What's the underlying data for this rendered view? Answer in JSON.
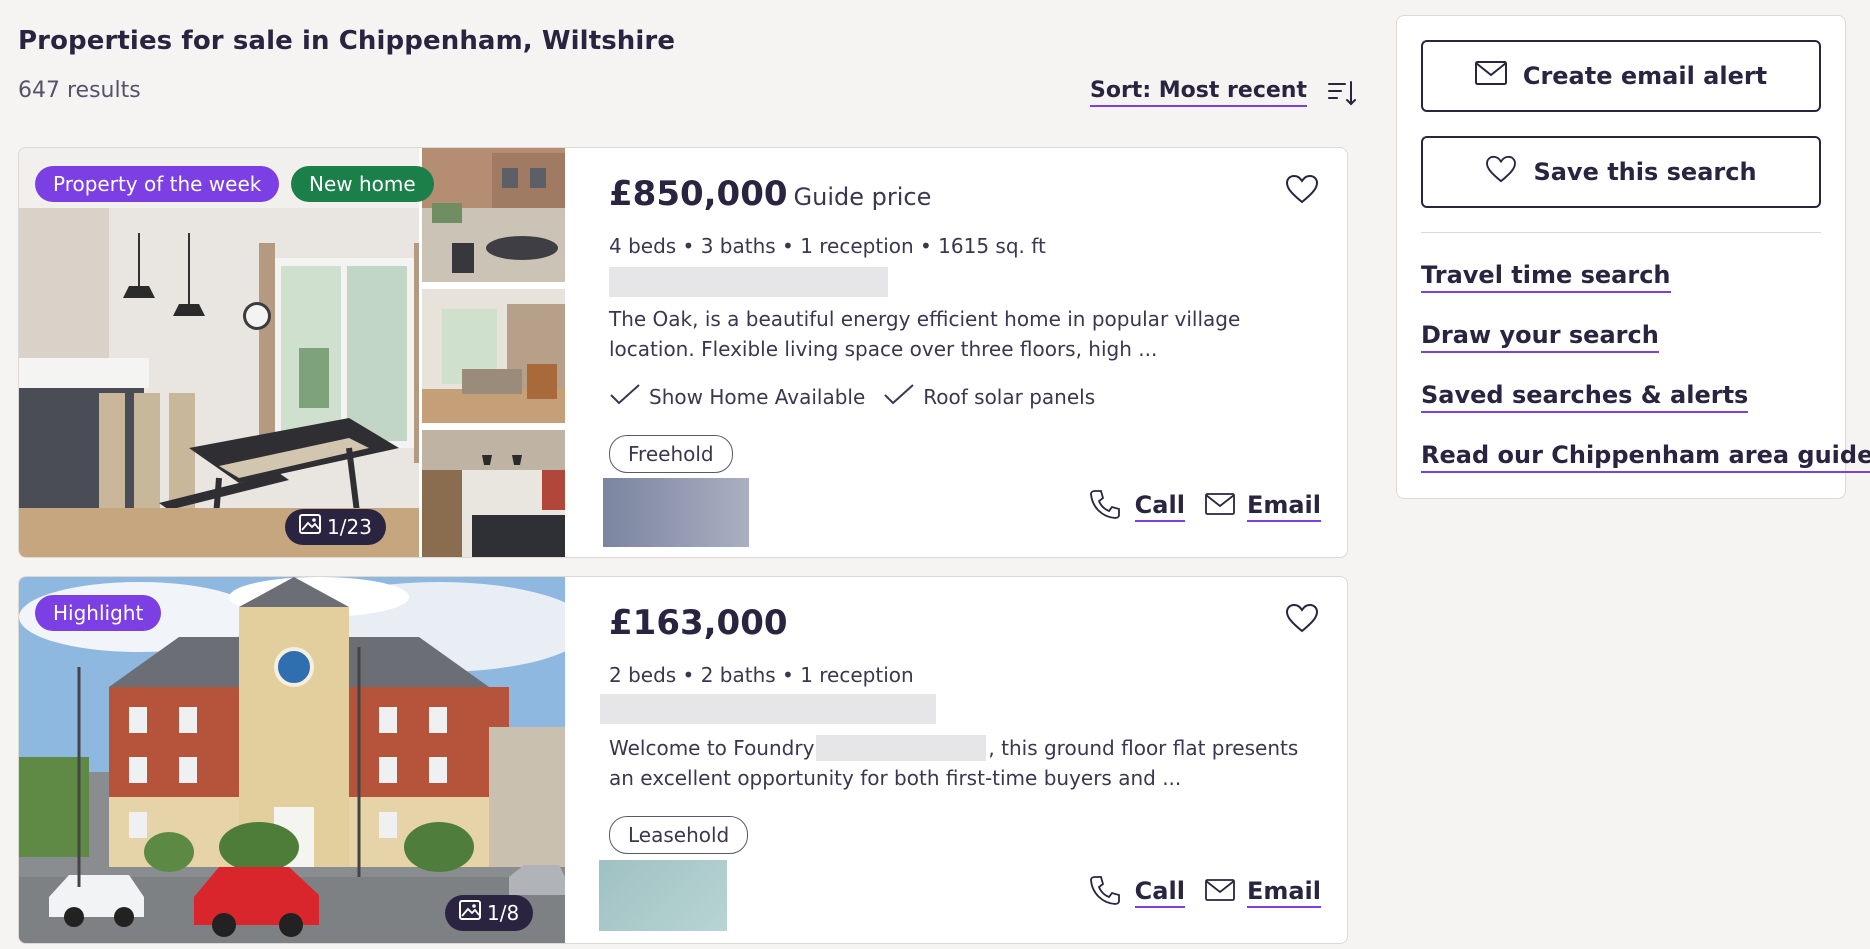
{
  "header": {
    "title": "Properties for sale in Chippenham, Wiltshire",
    "result_count": "647 results",
    "sort_label": "Sort: Most recent"
  },
  "listings": [
    {
      "badges": [
        "Property of the week",
        "New home"
      ],
      "photo_counter": "1/23",
      "price": "£850,000",
      "price_qualifier": "Guide price",
      "specs": "4 beds • 3 baths • 1 reception • 1615 sq. ft",
      "description": "The Oak, is a beautiful energy efficient home in popular village location. Flexible living space over three floors, high ...",
      "features": [
        "Show Home Available",
        "Roof solar panels"
      ],
      "tenure": "Freehold",
      "call_label": "Call",
      "email_label": "Email"
    },
    {
      "badges": [
        "Highlight"
      ],
      "photo_counter": "1/8",
      "price": "£163,000",
      "price_qualifier": "",
      "specs": "2 beds • 2 baths • 1 reception",
      "description_start": "Welcome to Foundry",
      "description_end": ", this ground floor flat presents an excellent opportunity for both first-time buyers and ...",
      "tenure": "Leasehold",
      "call_label": "Call",
      "email_label": "Email"
    }
  ],
  "sidebar": {
    "create_alert_label": "Create email alert",
    "save_search_label": "Save this search",
    "links": [
      "Travel time search",
      "Draw your search",
      "Saved searches & alerts",
      "Read our Chippenham area guide"
    ]
  },
  "colors": {
    "brand_purple": "#7b3fe4",
    "new_home_green": "#1b7f4a",
    "text_dark": "#2a2440"
  },
  "icons": [
    "sort-icon",
    "image-icon",
    "heart-icon",
    "phone-icon",
    "envelope-icon",
    "check-icon"
  ]
}
